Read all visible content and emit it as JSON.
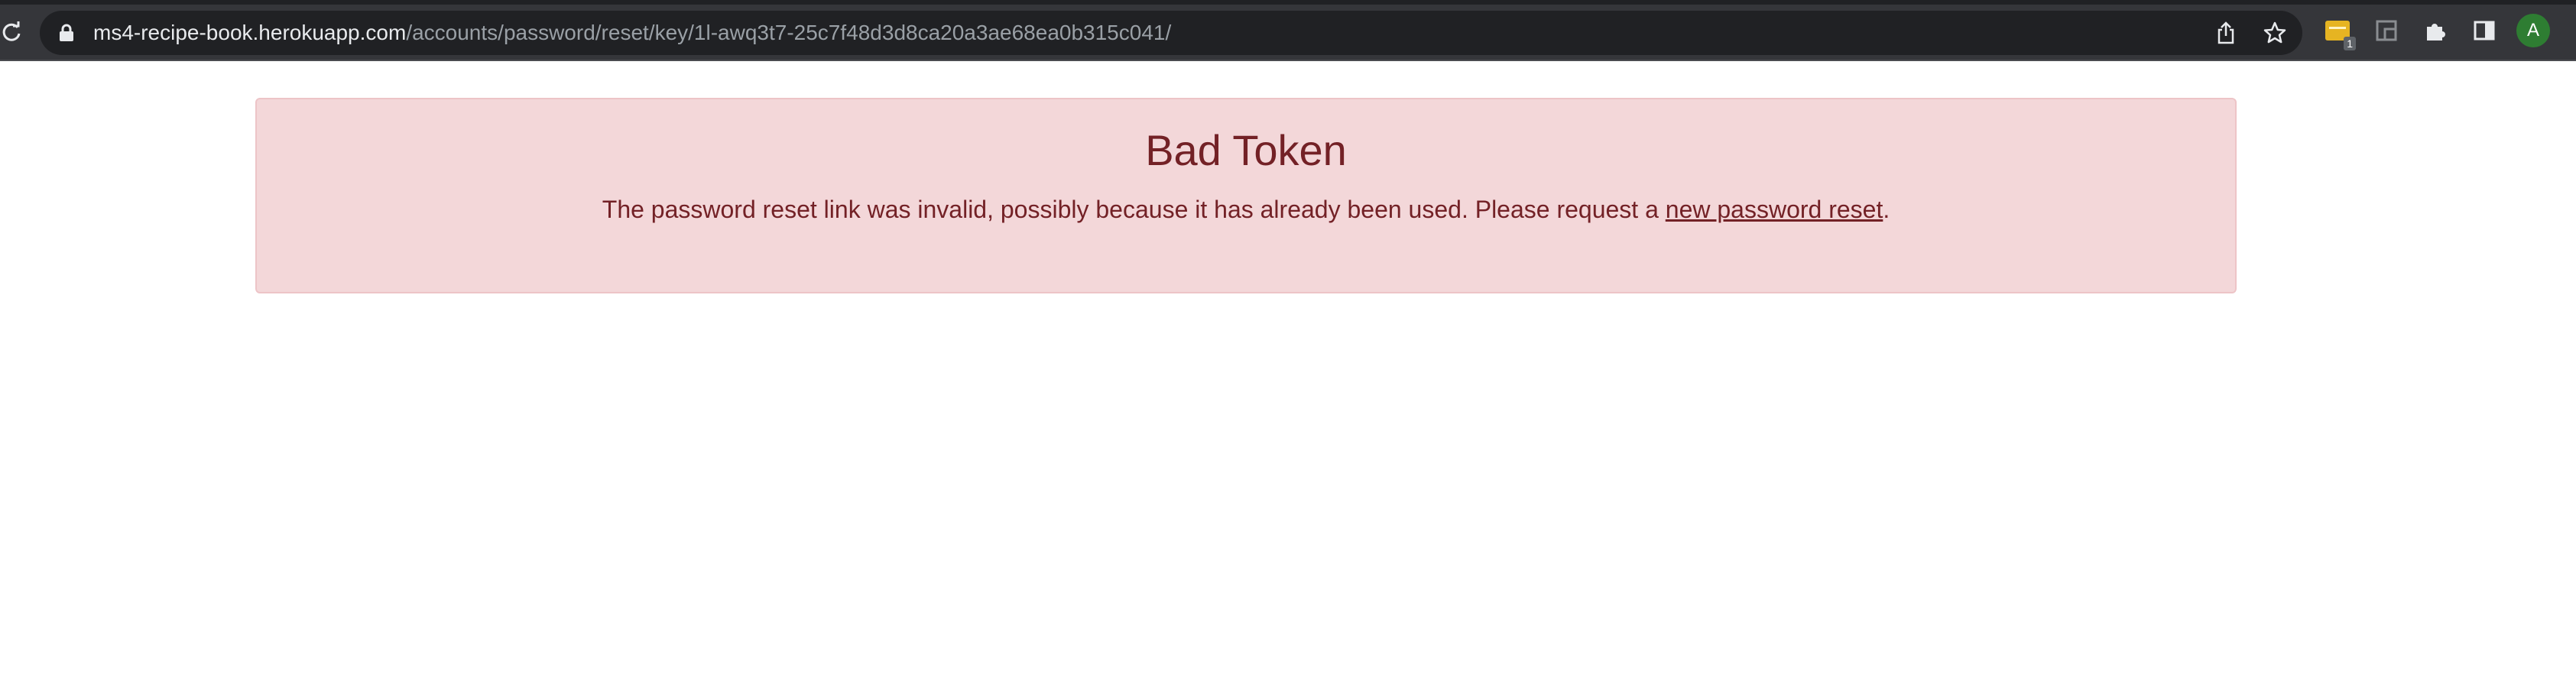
{
  "browser": {
    "url_host": "ms4-recipe-book.herokuapp.com",
    "url_path": "/accounts/password/reset/key/1l-awq3t7-25c7f48d3d8ca20a3ae68ea0b315c041/",
    "extension_badge": "1",
    "avatar_initial": "A",
    "avatar_color": "#2e7d32"
  },
  "alert": {
    "title": "Bad Token",
    "message_before": "The password reset link was invalid, possibly because it has already been used. Please request a ",
    "link_text": "new password reset",
    "message_after": ".",
    "background": "#f3d7d9",
    "text_color": "#732126"
  }
}
